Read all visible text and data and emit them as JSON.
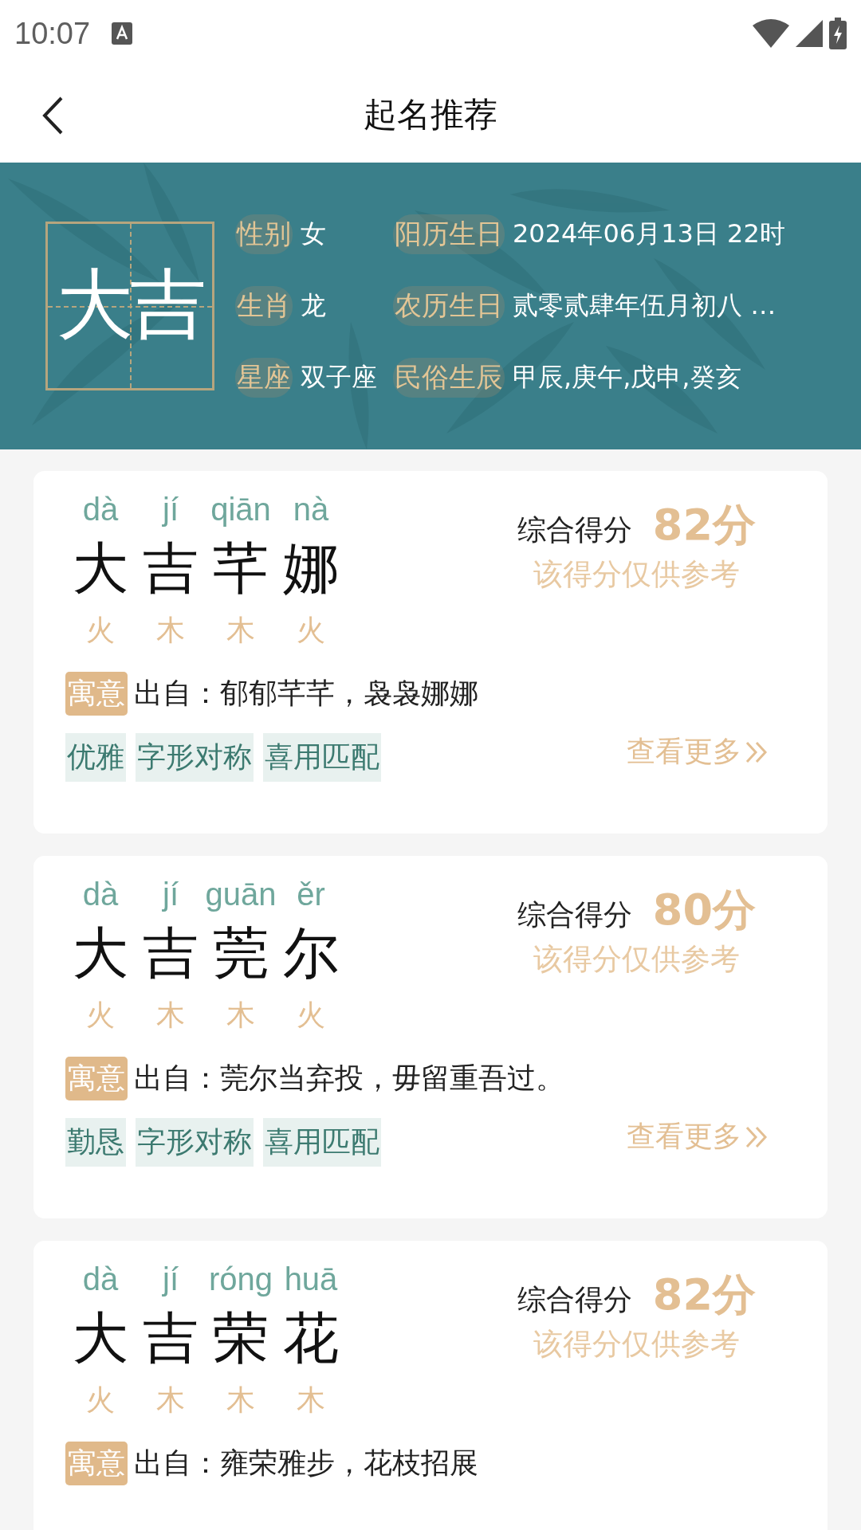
{
  "status_bar": {
    "time": "10:07"
  },
  "header": {
    "title": "起名推荐"
  },
  "banner": {
    "name": "大吉",
    "rows": [
      {
        "label": "性别",
        "value": "女",
        "label2": "阳历生日",
        "value2": "2024年06月13日 22时"
      },
      {
        "label": "生肖",
        "value": "龙",
        "label2": "农历生日",
        "value2": "贰零贰肆年伍月初八 …"
      },
      {
        "label": "星座",
        "value": "双子座",
        "label2": "民俗生辰",
        "value2": "甲辰,庚午,戊申,癸亥"
      }
    ]
  },
  "names": [
    {
      "chars": [
        {
          "pinyin": "dà",
          "char": "大",
          "element": "火"
        },
        {
          "pinyin": "jí",
          "char": "吉",
          "element": "木"
        },
        {
          "pinyin": "qiān",
          "char": "芊",
          "element": "木"
        },
        {
          "pinyin": "nà",
          "char": "娜",
          "element": "火"
        }
      ],
      "score_label": "综合得分",
      "score": "82分",
      "score_note": "该得分仅供参考",
      "meaning_tag": "寓意",
      "meaning": "出自：郁郁芊芊，袅袅娜娜",
      "tags": [
        "优雅",
        "字形对称",
        "喜用匹配"
      ],
      "more": "查看更多"
    },
    {
      "chars": [
        {
          "pinyin": "dà",
          "char": "大",
          "element": "火"
        },
        {
          "pinyin": "jí",
          "char": "吉",
          "element": "木"
        },
        {
          "pinyin": "guān",
          "char": "莞",
          "element": "木"
        },
        {
          "pinyin": "ěr",
          "char": "尔",
          "element": "火"
        }
      ],
      "score_label": "综合得分",
      "score": "80分",
      "score_note": "该得分仅供参考",
      "meaning_tag": "寓意",
      "meaning": "出自：莞尔当弃投，毋留重吾过。",
      "tags": [
        "勤恳",
        "字形对称",
        "喜用匹配"
      ],
      "more": "查看更多"
    },
    {
      "chars": [
        {
          "pinyin": "dà",
          "char": "大",
          "element": "火"
        },
        {
          "pinyin": "jí",
          "char": "吉",
          "element": "木"
        },
        {
          "pinyin": "róng",
          "char": "荣",
          "element": "木"
        },
        {
          "pinyin": "huā",
          "char": "花",
          "element": "木"
        }
      ],
      "score_label": "综合得分",
      "score": "82分",
      "score_note": "该得分仅供参考",
      "meaning_tag": "寓意",
      "meaning": "出自：雍荣雅步，花枝招展"
    }
  ]
}
